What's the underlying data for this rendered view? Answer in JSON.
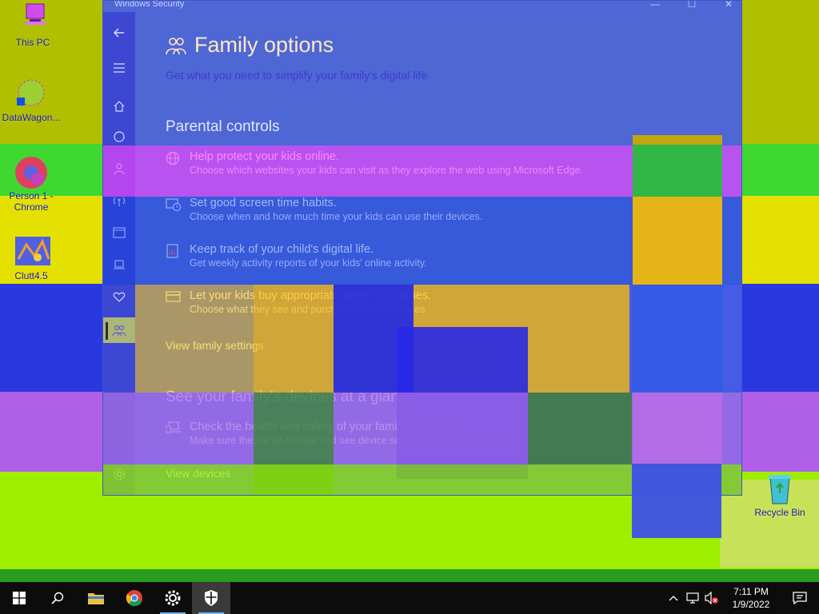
{
  "desktop": {
    "icons": [
      {
        "label": "This PC",
        "icon": "computer-icon"
      },
      {
        "label": "DataWagon...",
        "icon": "shortcut-icon"
      },
      {
        "label": "Person 1 -\nChrome",
        "icon": "chrome-profile-icon"
      },
      {
        "label": "Clutt4.5",
        "icon": "app-shortcut-icon"
      },
      {
        "label": "Recycle Bin",
        "icon": "recycle-bin-icon"
      }
    ]
  },
  "window": {
    "title": "Windows Security",
    "controls": {
      "minimize": "—",
      "maximize": "☐",
      "close": "✕"
    },
    "nav": [
      "back-icon",
      "menu-icon",
      "home-icon",
      "virus-protection-icon",
      "account-protection-icon",
      "firewall-icon",
      "app-browser-icon",
      "device-security-icon",
      "device-performance-icon",
      "family-options-icon",
      "settings-icon"
    ],
    "page": {
      "title": "Family options",
      "subtitle": "Get what you need to simplify your family's digital life.",
      "parental": {
        "heading": "Parental controls",
        "items": [
          {
            "title": "Help protect your kids online.",
            "desc": "Choose which websites your kids can visit as they explore the web using Microsoft Edge.",
            "icon": "globe-icon"
          },
          {
            "title": "Set good screen time habits.",
            "desc": "Choose when and how much time your kids can use their devices.",
            "icon": "screen-time-icon"
          },
          {
            "title": "Keep track of your child's digital life.",
            "desc": "Get weekly activity reports of your kids' online activity.",
            "icon": "report-icon"
          },
          {
            "title": "Let your kids buy appropriate apps and games.",
            "desc": "Choose what they see and purchase for their devices.",
            "icon": "card-icon"
          }
        ],
        "link": "View family settings"
      },
      "devices": {
        "heading": "See your family's devices at a glance",
        "items": [
          {
            "title": "Check the health and safety of your family's devices.",
            "desc": "Make sure they're up-to-date and see device security and health status.",
            "icon": "devices-icon"
          }
        ],
        "link": "View devices"
      }
    }
  },
  "taskbar": {
    "time": "7:11 PM",
    "date": "1/9/2022",
    "buttons": [
      "start-icon",
      "search-icon",
      "file-explorer-icon",
      "chrome-icon",
      "settings-icon",
      "windows-security-icon"
    ]
  }
}
